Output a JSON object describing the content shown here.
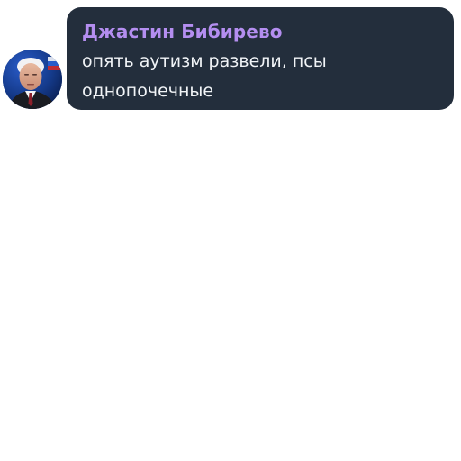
{
  "message": {
    "sender_name": "Джастин Бибирево",
    "text_lines": [
      "опять аутизм развели, псы",
      "однопочечные"
    ],
    "sender_color": "#b48ef0",
    "bubble_color": "#232e3c",
    "text_color": "#f1f4f7"
  },
  "avatar": {
    "icon": "profile-photo"
  }
}
